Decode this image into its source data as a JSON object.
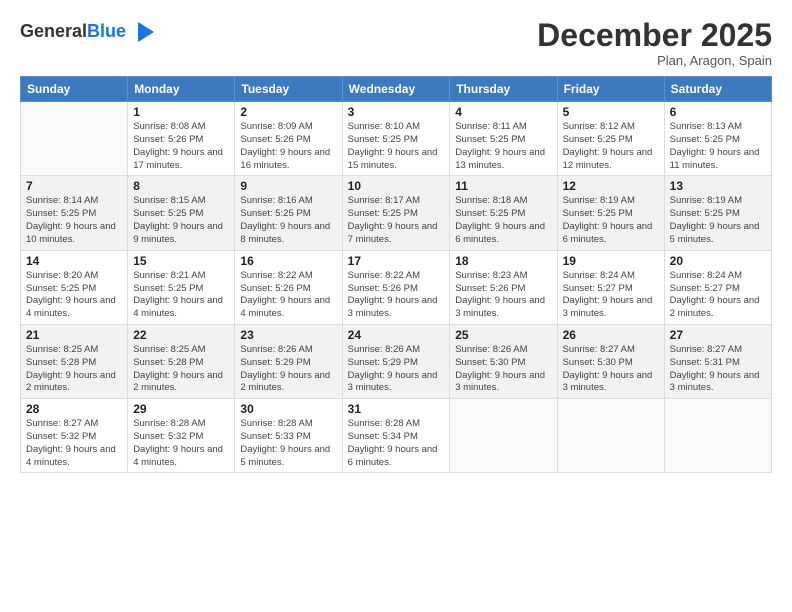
{
  "header": {
    "logo_general": "General",
    "logo_blue": "Blue",
    "month_title": "December 2025",
    "location": "Plan, Aragon, Spain"
  },
  "weekdays": [
    "Sunday",
    "Monday",
    "Tuesday",
    "Wednesday",
    "Thursday",
    "Friday",
    "Saturday"
  ],
  "weeks": [
    [
      {
        "day": "",
        "info": ""
      },
      {
        "day": "1",
        "info": "Sunrise: 8:08 AM\nSunset: 5:26 PM\nDaylight: 9 hours\nand 17 minutes."
      },
      {
        "day": "2",
        "info": "Sunrise: 8:09 AM\nSunset: 5:26 PM\nDaylight: 9 hours\nand 16 minutes."
      },
      {
        "day": "3",
        "info": "Sunrise: 8:10 AM\nSunset: 5:25 PM\nDaylight: 9 hours\nand 15 minutes."
      },
      {
        "day": "4",
        "info": "Sunrise: 8:11 AM\nSunset: 5:25 PM\nDaylight: 9 hours\nand 13 minutes."
      },
      {
        "day": "5",
        "info": "Sunrise: 8:12 AM\nSunset: 5:25 PM\nDaylight: 9 hours\nand 12 minutes."
      },
      {
        "day": "6",
        "info": "Sunrise: 8:13 AM\nSunset: 5:25 PM\nDaylight: 9 hours\nand 11 minutes."
      }
    ],
    [
      {
        "day": "7",
        "info": "Sunrise: 8:14 AM\nSunset: 5:25 PM\nDaylight: 9 hours\nand 10 minutes."
      },
      {
        "day": "8",
        "info": "Sunrise: 8:15 AM\nSunset: 5:25 PM\nDaylight: 9 hours\nand 9 minutes."
      },
      {
        "day": "9",
        "info": "Sunrise: 8:16 AM\nSunset: 5:25 PM\nDaylight: 9 hours\nand 8 minutes."
      },
      {
        "day": "10",
        "info": "Sunrise: 8:17 AM\nSunset: 5:25 PM\nDaylight: 9 hours\nand 7 minutes."
      },
      {
        "day": "11",
        "info": "Sunrise: 8:18 AM\nSunset: 5:25 PM\nDaylight: 9 hours\nand 6 minutes."
      },
      {
        "day": "12",
        "info": "Sunrise: 8:19 AM\nSunset: 5:25 PM\nDaylight: 9 hours\nand 6 minutes."
      },
      {
        "day": "13",
        "info": "Sunrise: 8:19 AM\nSunset: 5:25 PM\nDaylight: 9 hours\nand 5 minutes."
      }
    ],
    [
      {
        "day": "14",
        "info": "Sunrise: 8:20 AM\nSunset: 5:25 PM\nDaylight: 9 hours\nand 4 minutes."
      },
      {
        "day": "15",
        "info": "Sunrise: 8:21 AM\nSunset: 5:25 PM\nDaylight: 9 hours\nand 4 minutes."
      },
      {
        "day": "16",
        "info": "Sunrise: 8:22 AM\nSunset: 5:26 PM\nDaylight: 9 hours\nand 4 minutes."
      },
      {
        "day": "17",
        "info": "Sunrise: 8:22 AM\nSunset: 5:26 PM\nDaylight: 9 hours\nand 3 minutes."
      },
      {
        "day": "18",
        "info": "Sunrise: 8:23 AM\nSunset: 5:26 PM\nDaylight: 9 hours\nand 3 minutes."
      },
      {
        "day": "19",
        "info": "Sunrise: 8:24 AM\nSunset: 5:27 PM\nDaylight: 9 hours\nand 3 minutes."
      },
      {
        "day": "20",
        "info": "Sunrise: 8:24 AM\nSunset: 5:27 PM\nDaylight: 9 hours\nand 2 minutes."
      }
    ],
    [
      {
        "day": "21",
        "info": "Sunrise: 8:25 AM\nSunset: 5:28 PM\nDaylight: 9 hours\nand 2 minutes."
      },
      {
        "day": "22",
        "info": "Sunrise: 8:25 AM\nSunset: 5:28 PM\nDaylight: 9 hours\nand 2 minutes."
      },
      {
        "day": "23",
        "info": "Sunrise: 8:26 AM\nSunset: 5:29 PM\nDaylight: 9 hours\nand 2 minutes."
      },
      {
        "day": "24",
        "info": "Sunrise: 8:26 AM\nSunset: 5:29 PM\nDaylight: 9 hours\nand 3 minutes."
      },
      {
        "day": "25",
        "info": "Sunrise: 8:26 AM\nSunset: 5:30 PM\nDaylight: 9 hours\nand 3 minutes."
      },
      {
        "day": "26",
        "info": "Sunrise: 8:27 AM\nSunset: 5:30 PM\nDaylight: 9 hours\nand 3 minutes."
      },
      {
        "day": "27",
        "info": "Sunrise: 8:27 AM\nSunset: 5:31 PM\nDaylight: 9 hours\nand 3 minutes."
      }
    ],
    [
      {
        "day": "28",
        "info": "Sunrise: 8:27 AM\nSunset: 5:32 PM\nDaylight: 9 hours\nand 4 minutes."
      },
      {
        "day": "29",
        "info": "Sunrise: 8:28 AM\nSunset: 5:32 PM\nDaylight: 9 hours\nand 4 minutes."
      },
      {
        "day": "30",
        "info": "Sunrise: 8:28 AM\nSunset: 5:33 PM\nDaylight: 9 hours\nand 5 minutes."
      },
      {
        "day": "31",
        "info": "Sunrise: 8:28 AM\nSunset: 5:34 PM\nDaylight: 9 hours\nand 6 minutes."
      },
      {
        "day": "",
        "info": ""
      },
      {
        "day": "",
        "info": ""
      },
      {
        "day": "",
        "info": ""
      }
    ]
  ]
}
